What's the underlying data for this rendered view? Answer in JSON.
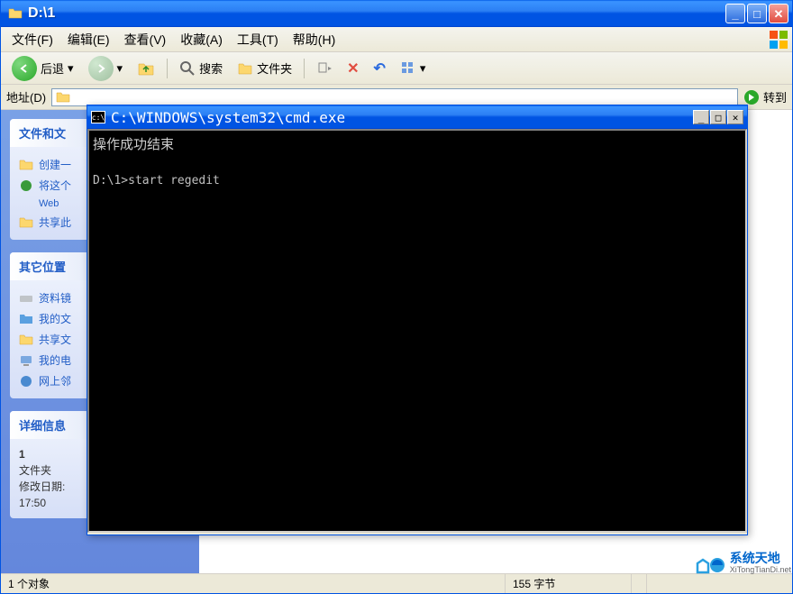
{
  "explorer": {
    "title": "D:\\1",
    "menu": {
      "file": "文件(F)",
      "edit": "编辑(E)",
      "view": "查看(V)",
      "favorites": "收藏(A)",
      "tools": "工具(T)",
      "help": "帮助(H)"
    },
    "toolbar": {
      "back": "后退",
      "search": "搜索",
      "folders": "文件夹"
    },
    "addressbar": {
      "label": "地址(D)",
      "go": "转到"
    },
    "sidebar": {
      "tasks": {
        "title": "文件和文",
        "items": [
          "创建一",
          "将这个",
          "Web",
          "共享此"
        ]
      },
      "places": {
        "title": "其它位置",
        "items": [
          "资料镜",
          "我的文",
          "共享文",
          "我的电",
          "网上邻"
        ]
      },
      "details": {
        "title": "详细信息",
        "name": "1",
        "type": "文件夹",
        "modified_label": "修改日期:",
        "modified_time": "17:50"
      }
    },
    "statusbar": {
      "objects": "1 个对象",
      "size": "155 字节"
    }
  },
  "cmd": {
    "title": "C:\\WINDOWS\\system32\\cmd.exe",
    "output_line": "操作成功结束",
    "prompt": "D:\\1>start regedit"
  },
  "watermark": {
    "cn": "系统天地",
    "en": "XiTongTianDi.net"
  }
}
